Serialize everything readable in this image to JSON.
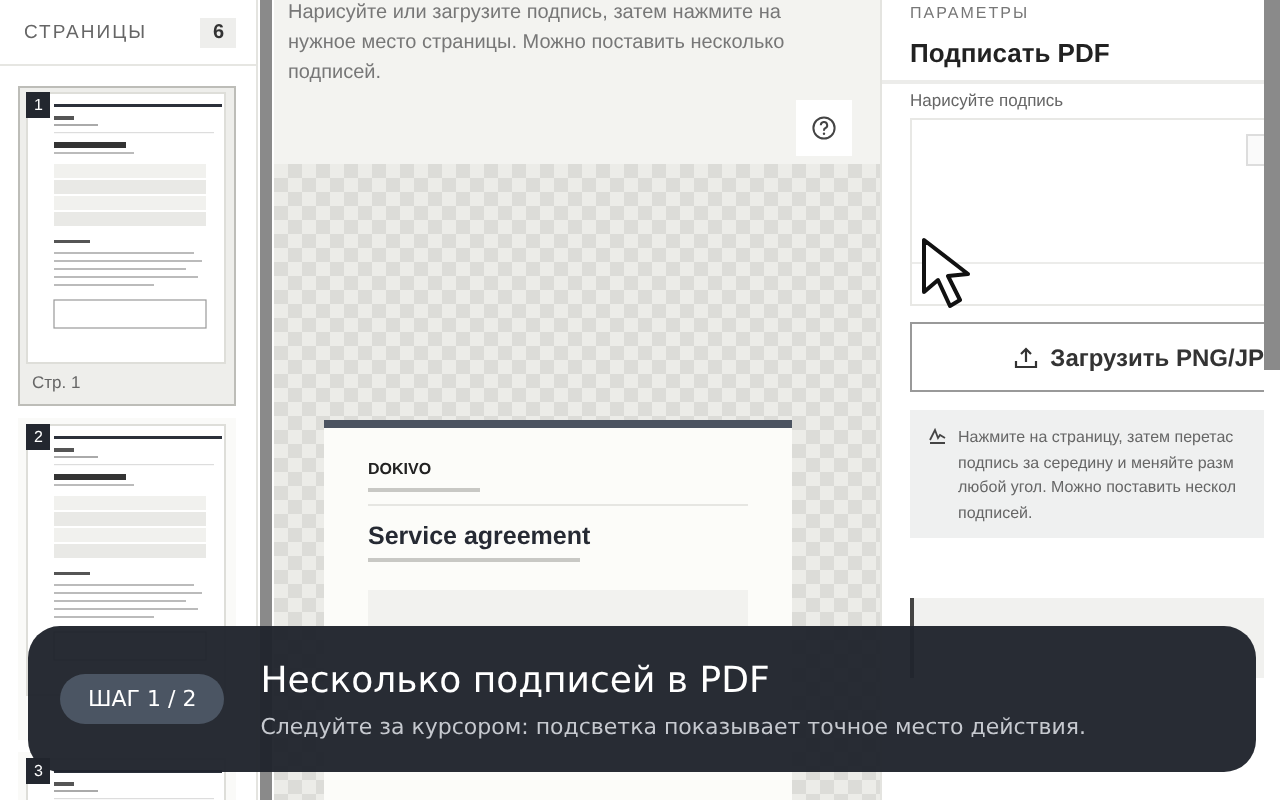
{
  "sidebar": {
    "title": "СТРАНИЦЫ",
    "count": "6",
    "pages": [
      {
        "number": "1",
        "caption": "Стр. 1",
        "selected": true
      },
      {
        "number": "2",
        "selected": false
      },
      {
        "number": "3",
        "selected": false
      }
    ]
  },
  "canvas": {
    "instructions": "Нарисуйте или загрузите подпись, затем нажмите на нужное место страницы. Можно поставить несколько подписей.",
    "document": {
      "brand": "DOKIVO",
      "title": "Service agreement"
    }
  },
  "panel": {
    "section": "ПАРАМЕТРЫ",
    "title": "Подписать PDF",
    "draw_label": "Нарисуйте подпись",
    "upload_button": "Загрузить PNG/JP",
    "hint_lines": [
      "Нажмите на страницу, затем перетас",
      "подпись за середину и меняйте разм",
      "любой угол. Можно поставить нескол",
      "подписей."
    ]
  },
  "tour": {
    "step": "ШАГ 1 / 2",
    "title": "Несколько подписей в PDF",
    "text": "Следуйте за курсором: подсветка показывает точное место действия."
  }
}
